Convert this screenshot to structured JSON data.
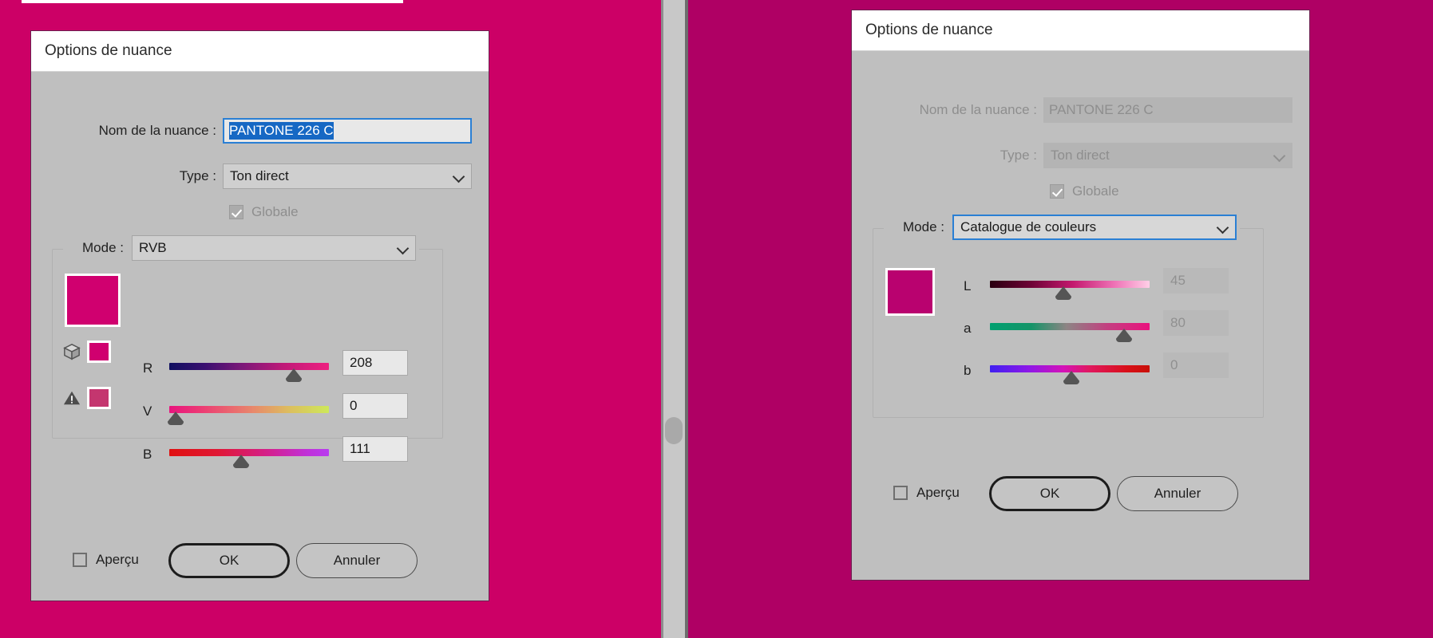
{
  "app": {
    "background_color_left": "#cc0066",
    "background_color_right": "#af0064",
    "swatch_color": "#d0006f"
  },
  "gutter": {
    "handle_name": "panel-resize-handle"
  },
  "left_dialog": {
    "title": "Options de nuance",
    "name_label": "Nom de la nuance :",
    "name_value": "PANTONE 226 C",
    "type_label": "Type :",
    "type_value": "Ton direct",
    "global_label": "Globale",
    "mode_label": "Mode :",
    "mode_value": "RVB",
    "channels": [
      {
        "label": "R",
        "value": "208",
        "pos_pct": 78
      },
      {
        "label": "V",
        "value": "0",
        "pos_pct": 1
      },
      {
        "label": "B",
        "value": "111",
        "pos_pct": 44
      }
    ],
    "preview_label": "Aperçu",
    "ok_label": "OK",
    "cancel_label": "Annuler"
  },
  "right_dialog": {
    "title": "Options de nuance",
    "name_label": "Nom de la nuance :",
    "name_value": "PANTONE 226 C",
    "type_label": "Type :",
    "type_value": "Ton direct",
    "global_label": "Globale",
    "mode_label": "Mode :",
    "mode_value": "Catalogue de couleurs",
    "channels": [
      {
        "label": "L",
        "value": "45",
        "pos_pct": 45
      },
      {
        "label": "a",
        "value": "80",
        "pos_pct": 84
      },
      {
        "label": "b",
        "value": "0",
        "pos_pct": 50
      }
    ],
    "preview_label": "Aperçu",
    "ok_label": "OK",
    "cancel_label": "Annuler"
  }
}
